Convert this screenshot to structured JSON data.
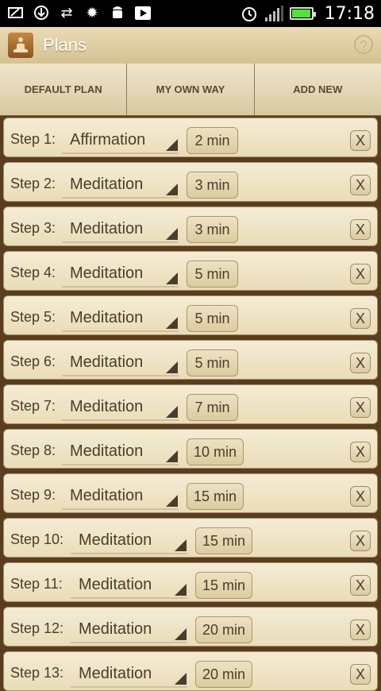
{
  "status_bar": {
    "time": "17:18",
    "icons": [
      "screen-edit-icon",
      "download-icon",
      "sync-icon",
      "settings-gear-icon",
      "android-icon",
      "play-store-icon",
      "alarm-icon",
      "signal-icon",
      "battery-icon"
    ]
  },
  "app_bar": {
    "title": "Plans",
    "help_label": "?"
  },
  "tabs": [
    {
      "label": "DEFAULT PLAN"
    },
    {
      "label": "MY OWN WAY"
    },
    {
      "label": "ADD NEW"
    }
  ],
  "steps": [
    {
      "label": "Step 1:",
      "activity": "Affirmation",
      "duration": "2 min",
      "remove": "X"
    },
    {
      "label": "Step 2:",
      "activity": "Meditation",
      "duration": "3 min",
      "remove": "X"
    },
    {
      "label": "Step 3:",
      "activity": "Meditation",
      "duration": "3 min",
      "remove": "X"
    },
    {
      "label": "Step 4:",
      "activity": "Meditation",
      "duration": "5 min",
      "remove": "X"
    },
    {
      "label": "Step 5:",
      "activity": "Meditation",
      "duration": "5 min",
      "remove": "X"
    },
    {
      "label": "Step 6:",
      "activity": "Meditation",
      "duration": "5 min",
      "remove": "X"
    },
    {
      "label": "Step 7:",
      "activity": "Meditation",
      "duration": "7 min",
      "remove": "X"
    },
    {
      "label": "Step 8:",
      "activity": "Meditation",
      "duration": "10 min",
      "remove": "X"
    },
    {
      "label": "Step 9:",
      "activity": "Meditation",
      "duration": "15 min",
      "remove": "X"
    },
    {
      "label": "Step 10:",
      "activity": "Meditation",
      "duration": "15 min",
      "remove": "X"
    },
    {
      "label": "Step 11:",
      "activity": "Meditation",
      "duration": "15 min",
      "remove": "X"
    },
    {
      "label": "Step 12:",
      "activity": "Meditation",
      "duration": "20 min",
      "remove": "X"
    },
    {
      "label": "Step 13:",
      "activity": "Meditation",
      "duration": "20 min",
      "remove": "X"
    }
  ]
}
